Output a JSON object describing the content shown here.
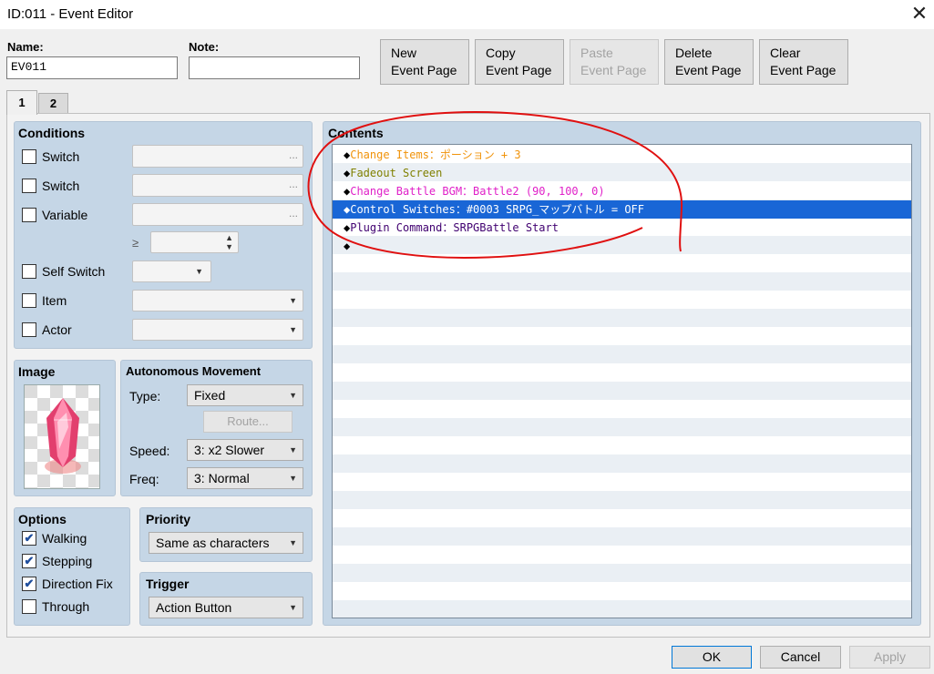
{
  "window": {
    "title": "ID:011 - Event Editor",
    "close_icon": "close-icon"
  },
  "header": {
    "name_label": "Name:",
    "name_value": "EV011",
    "note_label": "Note:",
    "note_value": "",
    "buttons": [
      {
        "line1": "New",
        "line2": "Event Page",
        "enabled": true
      },
      {
        "line1": "Copy",
        "line2": "Event Page",
        "enabled": true
      },
      {
        "line1": "Paste",
        "line2": "Event Page",
        "enabled": false
      },
      {
        "line1": "Delete",
        "line2": "Event Page",
        "enabled": true
      },
      {
        "line1": "Clear",
        "line2": "Event Page",
        "enabled": true
      }
    ]
  },
  "tabs": [
    {
      "label": "1",
      "active": true
    },
    {
      "label": "2",
      "active": false
    }
  ],
  "conditions": {
    "title": "Conditions",
    "rows": [
      {
        "label": "Switch",
        "type": "ellipsis",
        "ellipsis": "..."
      },
      {
        "label": "Switch",
        "type": "ellipsis",
        "ellipsis": "..."
      },
      {
        "label": "Variable",
        "type": "ellipsis",
        "ellipsis": "..."
      },
      {
        "label": "Self Switch",
        "type": "dropdown"
      },
      {
        "label": "Item",
        "type": "dropdown"
      },
      {
        "label": "Actor",
        "type": "dropdown"
      }
    ],
    "ge_symbol": "≥"
  },
  "image": {
    "title": "Image",
    "graphic": "pink-crystal-sprite"
  },
  "autonomous_movement": {
    "title": "Autonomous Movement",
    "type_label": "Type:",
    "type_value": "Fixed",
    "route_button": "Route...",
    "speed_label": "Speed:",
    "speed_value": "3: x2 Slower",
    "freq_label": "Freq:",
    "freq_value": "3: Normal"
  },
  "options": {
    "title": "Options",
    "items": [
      {
        "label": "Walking",
        "checked": true
      },
      {
        "label": "Stepping",
        "checked": true
      },
      {
        "label": "Direction Fix",
        "checked": true
      },
      {
        "label": "Through",
        "checked": false
      }
    ],
    "check_mark": "✔"
  },
  "priority": {
    "title": "Priority",
    "value": "Same as characters"
  },
  "trigger": {
    "title": "Trigger",
    "value": "Action Button"
  },
  "contents": {
    "title": "Contents",
    "diamond": "◆",
    "lines": [
      {
        "text": "Change Items：ポーション + 3",
        "color": "#f0930a",
        "selected": false
      },
      {
        "text": "Fadeout Screen",
        "color": "#808000",
        "selected": false
      },
      {
        "text": "Change Battle BGM：Battle2 (90, 100, 0)",
        "color": "#e020c8",
        "selected": false
      },
      {
        "text": "Control Switches：#0003 SRPG_マップバトル = OFF",
        "color": "#ffffff",
        "selected": true
      },
      {
        "text": "Plugin Command：SRPGBattle Start",
        "color": "#400070",
        "selected": false
      },
      {
        "text": "",
        "color": "#000000",
        "selected": false
      }
    ],
    "annotation_color": "#e01010"
  },
  "footer": {
    "ok": "OK",
    "cancel": "Cancel",
    "apply": "Apply"
  }
}
